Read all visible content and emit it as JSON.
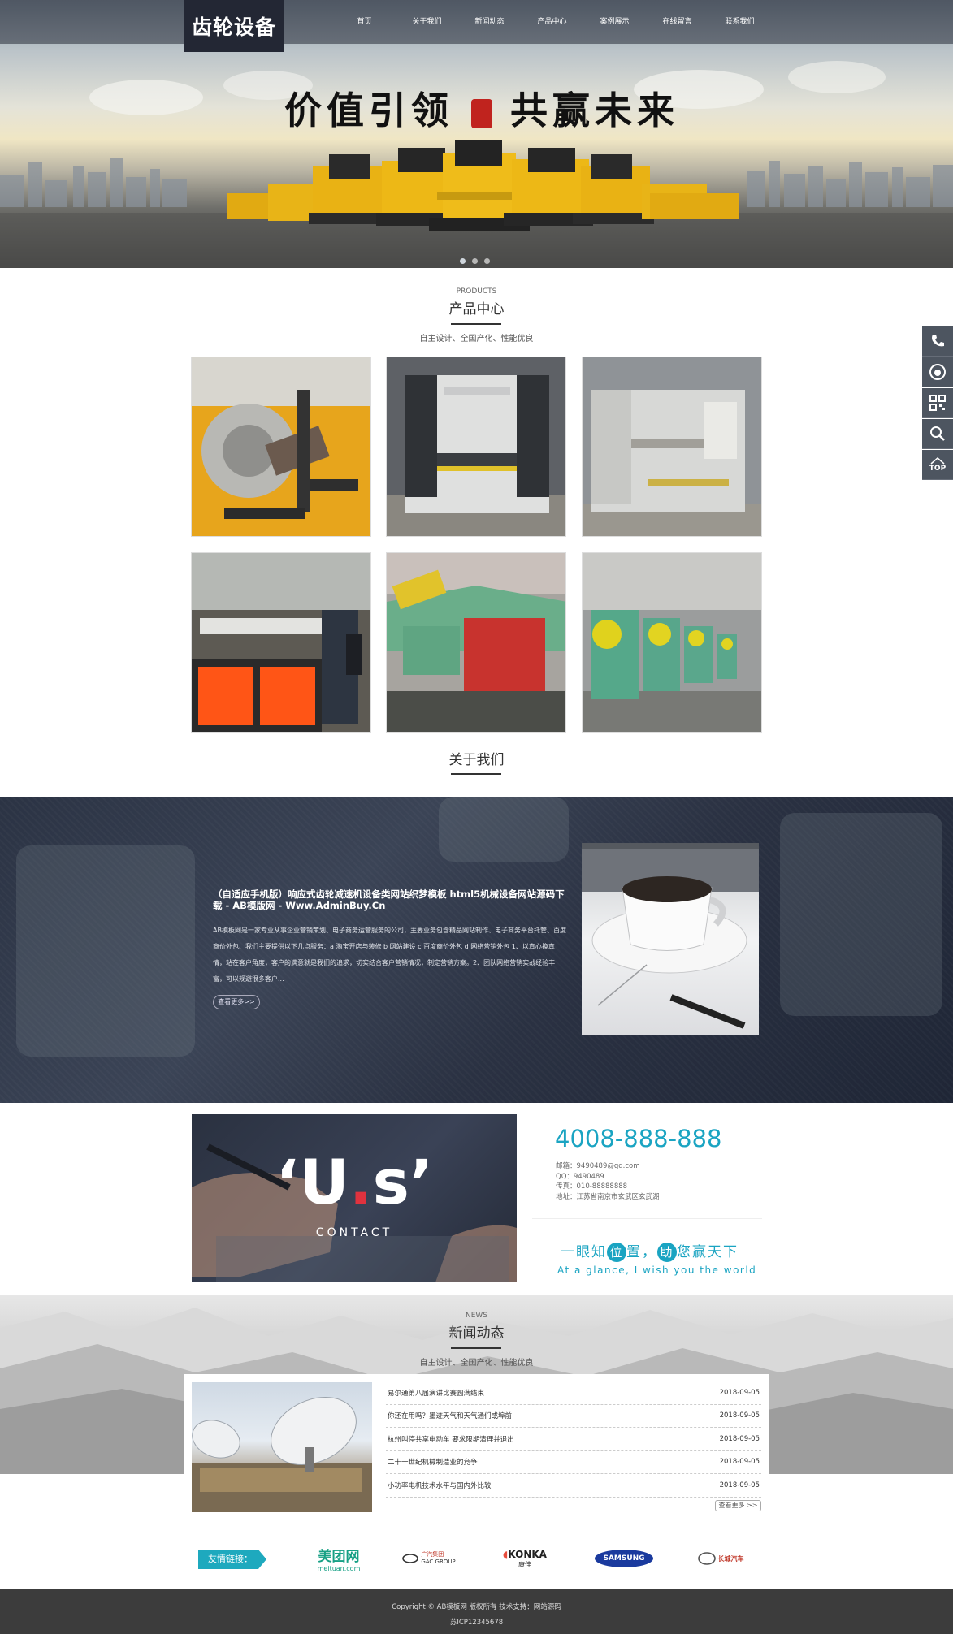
{
  "header": {
    "logo": "齿轮设备",
    "nav": [
      "首页",
      "关于我们",
      "新闻动态",
      "产品中心",
      "案例展示",
      "在线留言",
      "联系我们"
    ]
  },
  "banner": {
    "slogan_left": "价值引领",
    "slogan_right": "共赢未来"
  },
  "products": {
    "en": "PRODUCTS",
    "title": "产品中心",
    "subtitle": "自主设计、全国产化、性能优良"
  },
  "about": {
    "title": "关于我们",
    "heading": "（自适应手机版）响应式齿轮减速机设备类网站织梦模板 html5机械设备网站源码下载 - AB模版网 - Www.AdminBuy.Cn",
    "text": "AB模板网是一家专业从事企业营销策划、电子商务运营服务的公司，主要业务包含精品网站制作、电子商务平台托管、百度商价外包、我们主要提供以下几点服务：a 淘宝开店与装修 b 网站建设 c 百度商价外包 d 网络营销外包 1、以真心换真情，站在客户角度，客户的满意就是我们的追求，切实结合客户营销情况，制定营销方案。2、团队网络营销实战经验丰富，可以规避很多客户...",
    "more": "查看更多>>"
  },
  "contact": {
    "us_word": "'Us'",
    "label": "CONTACT",
    "phone": "4008-888-888",
    "email": "邮箱：9490489@qq.com",
    "qq": "QQ：9490489",
    "fax": "传真：010-88888888",
    "address": "地址：江苏省南京市玄武区玄武湖",
    "slogan": [
      "一眼知",
      "位",
      "置，",
      "助",
      "您赢天下"
    ],
    "slogan_en": "At a glance, I wish you the world"
  },
  "news": {
    "en": "NEWS",
    "title": "新闻动态",
    "subtitle": "自主设计、全国产化、性能优良",
    "items": [
      {
        "title": "易尔通第八届演讲比赛圆满结束",
        "date": "2018-09-05"
      },
      {
        "title": "你还在用吗？墨迹天气和天气通们或埠前",
        "date": "2018-09-05"
      },
      {
        "title": "杭州叫停共享电动车 要求限期清理并退出",
        "date": "2018-09-05"
      },
      {
        "title": "二十一世纪机械制造业的竞争",
        "date": "2018-09-05"
      },
      {
        "title": "小功率电机技术水平与国内外比较",
        "date": "2018-09-05"
      }
    ],
    "more": "查看更多 >>"
  },
  "links": {
    "label": "友情链接：",
    "partners": [
      {
        "name": "美团网",
        "sub": "meituan.com"
      },
      {
        "name": "广汽集团",
        "sub": "GAC GROUP"
      },
      {
        "name": "KONKA",
        "sub": "康佳"
      },
      {
        "name": "SAMSUNG",
        "sub": ""
      },
      {
        "name": "长城汽车",
        "sub": ""
      }
    ]
  },
  "footer": {
    "copyright": "Copyright © AB模板网 版权所有 技术支持：网站源码",
    "icp": "苏ICP12345678"
  },
  "side_tools": {
    "top_label": "TOP"
  },
  "colors": {
    "accent": "#1aa4c2",
    "dark": "#232734",
    "footer": "#3c3c3c"
  }
}
